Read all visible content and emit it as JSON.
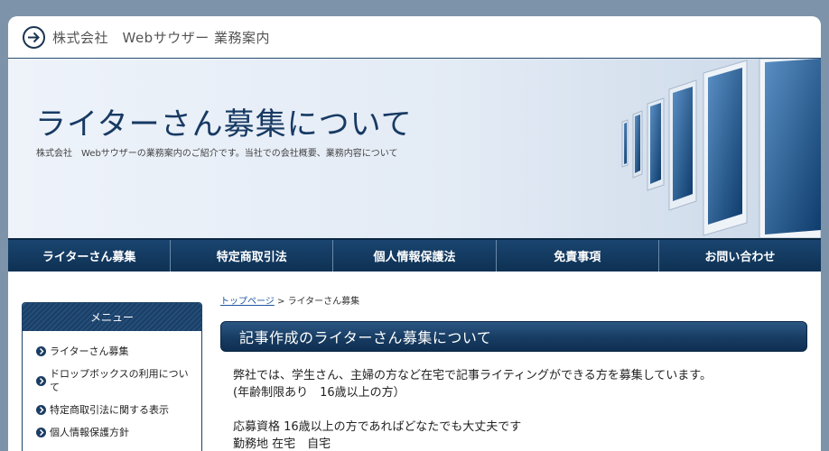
{
  "header": {
    "site_title": "株式会社　Webサウザー 業務案内"
  },
  "hero": {
    "title": "ライターさん募集について",
    "subtitle": "株式会社　Webサウザーの業務案内のご紹介です。当社での会社概要、業務内容について"
  },
  "nav": {
    "items": [
      {
        "label": "ライターさん募集"
      },
      {
        "label": "特定商取引法"
      },
      {
        "label": "個人情報保護法"
      },
      {
        "label": "免責事項"
      },
      {
        "label": "お問い合わせ"
      }
    ]
  },
  "sidebar": {
    "title": "メニュー",
    "items": [
      {
        "label": "ライターさん募集"
      },
      {
        "label": "ドロップボックスの利用について"
      },
      {
        "label": "特定商取引法に関する表示"
      },
      {
        "label": "個人情報保護方針"
      }
    ]
  },
  "breadcrumb": {
    "home": "トップページ",
    "separator": ">",
    "current": "ライターさん募集"
  },
  "main": {
    "section_title": "記事作成のライターさん募集について",
    "line1": "弊社では、学生さん、主婦の方など在宅で記事ライティングができる方を募集しています。",
    "line2": "(年齢制限あり　16歳以上の方）",
    "line3": "応募資格 16歳以上の方であればどなたでも大丈夫です",
    "line4": "勤務地 在宅　自宅"
  },
  "colors": {
    "brand": "#0f3558",
    "background": "#7d93aa",
    "accent_link": "#1e56a0"
  }
}
